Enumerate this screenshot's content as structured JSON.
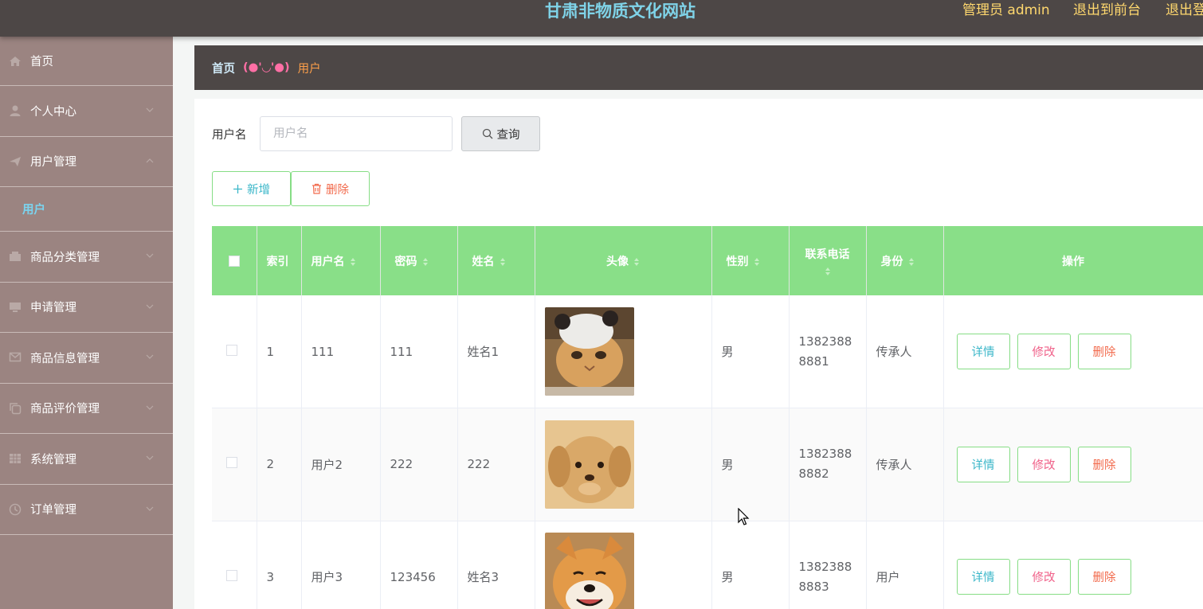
{
  "header": {
    "title": "甘肃非物质文化网站",
    "admin_label": "管理员 admin",
    "to_front_label": "退出到前台",
    "logout_label": "退出登录"
  },
  "sidebar": {
    "items": [
      {
        "label": "首页",
        "icon": "home-icon"
      },
      {
        "label": "个人中心",
        "icon": "user-icon"
      },
      {
        "label": "用户管理",
        "icon": "send-icon",
        "expanded": true,
        "children": [
          {
            "label": "用户"
          }
        ]
      },
      {
        "label": "商品分类管理",
        "icon": "box-icon"
      },
      {
        "label": "申请管理",
        "icon": "monitor-icon"
      },
      {
        "label": "商品信息管理",
        "icon": "message-icon"
      },
      {
        "label": "商品评价管理",
        "icon": "copy-icon"
      },
      {
        "label": "系统管理",
        "icon": "grid-icon"
      },
      {
        "label": "订单管理",
        "icon": "clock-icon"
      }
    ]
  },
  "breadcrumb": {
    "home": "首页",
    "separator": "(●'◡'●)",
    "current": "用户"
  },
  "search": {
    "label": "用户名",
    "placeholder": "用户名",
    "value": "",
    "button_label": "查询"
  },
  "actions": {
    "add_label": "新增",
    "delete_label": "删除"
  },
  "table": {
    "columns": [
      "索引",
      "用户名",
      "密码",
      "姓名",
      "头像",
      "性别",
      "联系电话",
      "身份",
      "操作"
    ],
    "rows": [
      {
        "index": "1",
        "username": "111",
        "password": "111",
        "name": "姓名1",
        "avatar": "cat-with-hat-photo",
        "gender": "男",
        "phone": "13823888881",
        "role": "传承人"
      },
      {
        "index": "2",
        "username": "用户2",
        "password": "222",
        "name": "222",
        "avatar": "puppy-photo",
        "gender": "男",
        "phone": "13823888882",
        "role": "传承人"
      },
      {
        "index": "3",
        "username": "用户3",
        "password": "123456",
        "name": "姓名3",
        "avatar": "shiba-dog-photo",
        "gender": "男",
        "phone": "13823888883",
        "role": "用户"
      }
    ],
    "row_actions": {
      "detail": "详情",
      "edit": "修改",
      "delete": "删除"
    }
  },
  "colors": {
    "header_bg": "#4d4746",
    "sidebar_bg": "#9b8481",
    "table_header_bg": "#89df88",
    "title_color": "#7fd3e8",
    "link_color": "#ffd86e"
  }
}
